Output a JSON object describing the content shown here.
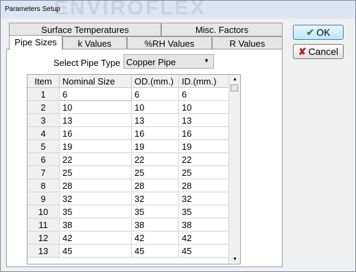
{
  "window": {
    "title": "Parameters Setup",
    "watermark": "ENVIROFLEX"
  },
  "tabs_row1": [
    {
      "label": "Surface Temperatures"
    },
    {
      "label": "Misc. Factors"
    }
  ],
  "tabs_row2": [
    {
      "label": "Pipe Sizes",
      "active": true
    },
    {
      "label": "k Values"
    },
    {
      "label": "%RH Values"
    },
    {
      "label": "R Values"
    }
  ],
  "buttons": {
    "ok": "OK",
    "ok_icon": "checkmark-icon",
    "cancel": "Cancel",
    "cancel_icon": "x-icon"
  },
  "pipe_type": {
    "label": "Select Pipe Type",
    "value": "Copper Pipe"
  },
  "grid": {
    "columns": [
      "Item",
      "Nominal Size",
      "OD.(mm.)",
      "ID.(mm.)"
    ],
    "rows": [
      [
        "1",
        "6",
        "6",
        "6"
      ],
      [
        "2",
        "10",
        "10",
        "10"
      ],
      [
        "3",
        "13",
        "13",
        "13"
      ],
      [
        "4",
        "16",
        "16",
        "16"
      ],
      [
        "5",
        "19",
        "19",
        "19"
      ],
      [
        "6",
        "22",
        "22",
        "22"
      ],
      [
        "7",
        "25",
        "25",
        "25"
      ],
      [
        "8",
        "28",
        "28",
        "28"
      ],
      [
        "9",
        "32",
        "32",
        "32"
      ],
      [
        "10",
        "35",
        "35",
        "35"
      ],
      [
        "11",
        "38",
        "38",
        "38"
      ],
      [
        "12",
        "42",
        "42",
        "42"
      ],
      [
        "13",
        "45",
        "45",
        "45"
      ]
    ]
  }
}
